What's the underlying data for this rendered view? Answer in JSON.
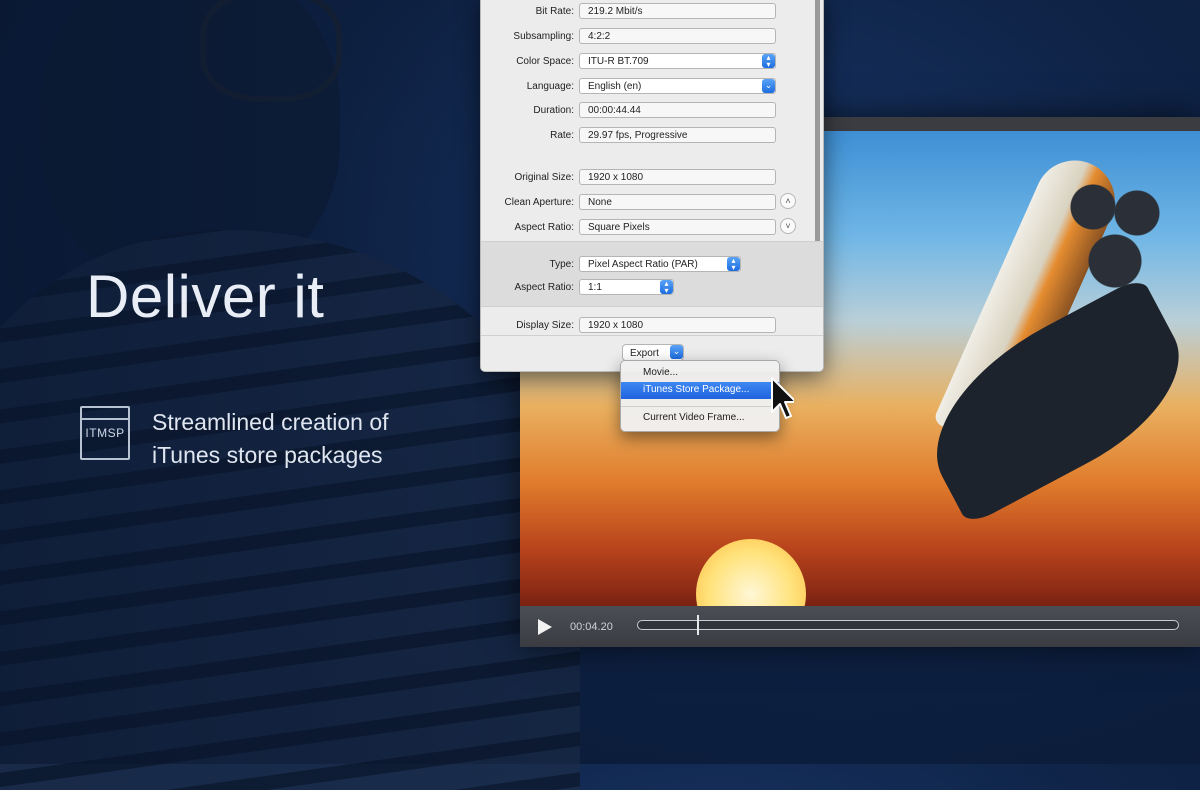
{
  "headline": "Deliver it",
  "feature": {
    "icon_text": "ITMSP",
    "line1": "Streamlined creation of",
    "line2": "iTunes store packages"
  },
  "inspector": {
    "rows": [
      {
        "label": "Bit Rate:",
        "value": "219.2 Mbit/s"
      },
      {
        "label": "Subsampling:",
        "value": "4:2:2"
      },
      {
        "label": "Color Space:",
        "value": "ITU-R BT.709"
      },
      {
        "label": "Language:",
        "value": "English (en)"
      },
      {
        "label": "Duration:",
        "value": "00:00:44.44"
      },
      {
        "label": "Rate:",
        "value": "29.97 fps, Progressive"
      },
      {
        "label": "Original Size:",
        "value": "1920 x 1080"
      },
      {
        "label": "Clean Aperture:",
        "value": "None"
      },
      {
        "label": "Aspect Ratio:",
        "value": "Square Pixels"
      },
      {
        "label": "Type:",
        "value": "Pixel Aspect Ratio (PAR)"
      },
      {
        "label": "Aspect Ratio:",
        "value": "1:1"
      },
      {
        "label": "Display Size:",
        "value": "1920 x 1080"
      }
    ],
    "export_label": "Export"
  },
  "export_menu": {
    "items": [
      "Movie...",
      "iTunes Store Package...",
      "Current Video Frame..."
    ],
    "highlighted_index": 1
  },
  "player": {
    "timecode": "00:04.20",
    "progress_fraction": 0.11
  },
  "colors": {
    "menu_highlight": "#1e63dd",
    "background_navy": "#0f2448"
  }
}
